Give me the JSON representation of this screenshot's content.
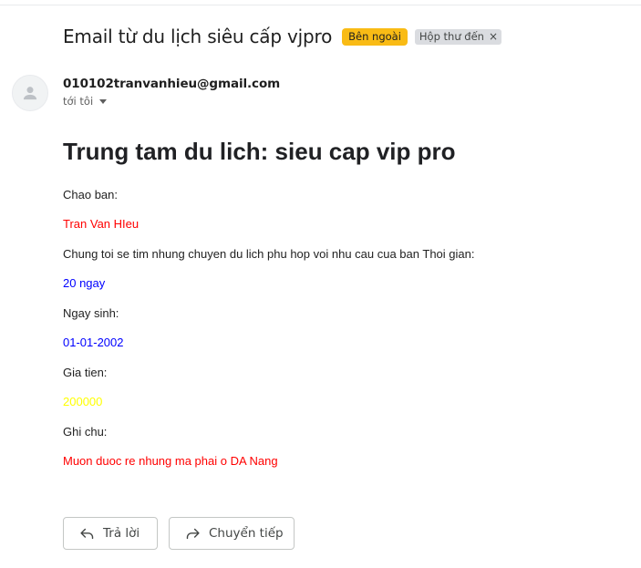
{
  "email": {
    "subject": "Email từ du lịch siêu cấp vjpro",
    "labels": {
      "external": "Bên ngoài",
      "inbox": "Hộp thư đến",
      "inbox_remove": "×"
    },
    "sender": "010102tranvanhieu@gmail.com",
    "recipient_label": "tới tôi"
  },
  "body": {
    "heading": "Trung tam du lich: sieu cap vip pro",
    "greeting": "Chao ban:",
    "customer_name": "Tran Van HIeu",
    "intro": "Chung toi se tim nhung chuyen du lich phu hop voi nhu cau cua ban Thoi gian:",
    "duration": "20 ngay",
    "dob_label": "Ngay sinh:",
    "dob": "01-01-2002",
    "price_label": "Gia tien:",
    "price": "200000",
    "note_label": "Ghi chu:",
    "note": "Muon duoc re nhung ma phai o DA Nang"
  },
  "actions": {
    "reply": "Trả lời",
    "forward": "Chuyển tiếp"
  },
  "colors": {
    "external_badge": "#f9bb15",
    "inbox_badge": "#dadce0",
    "red_text": "#ff0000",
    "blue_text": "#0000ff",
    "yellow_text": "#ffff00"
  },
  "icons": {
    "avatar": "person-icon",
    "reply": "reply-icon",
    "forward": "forward-icon",
    "recipient_toggle": "caret-down-icon"
  }
}
